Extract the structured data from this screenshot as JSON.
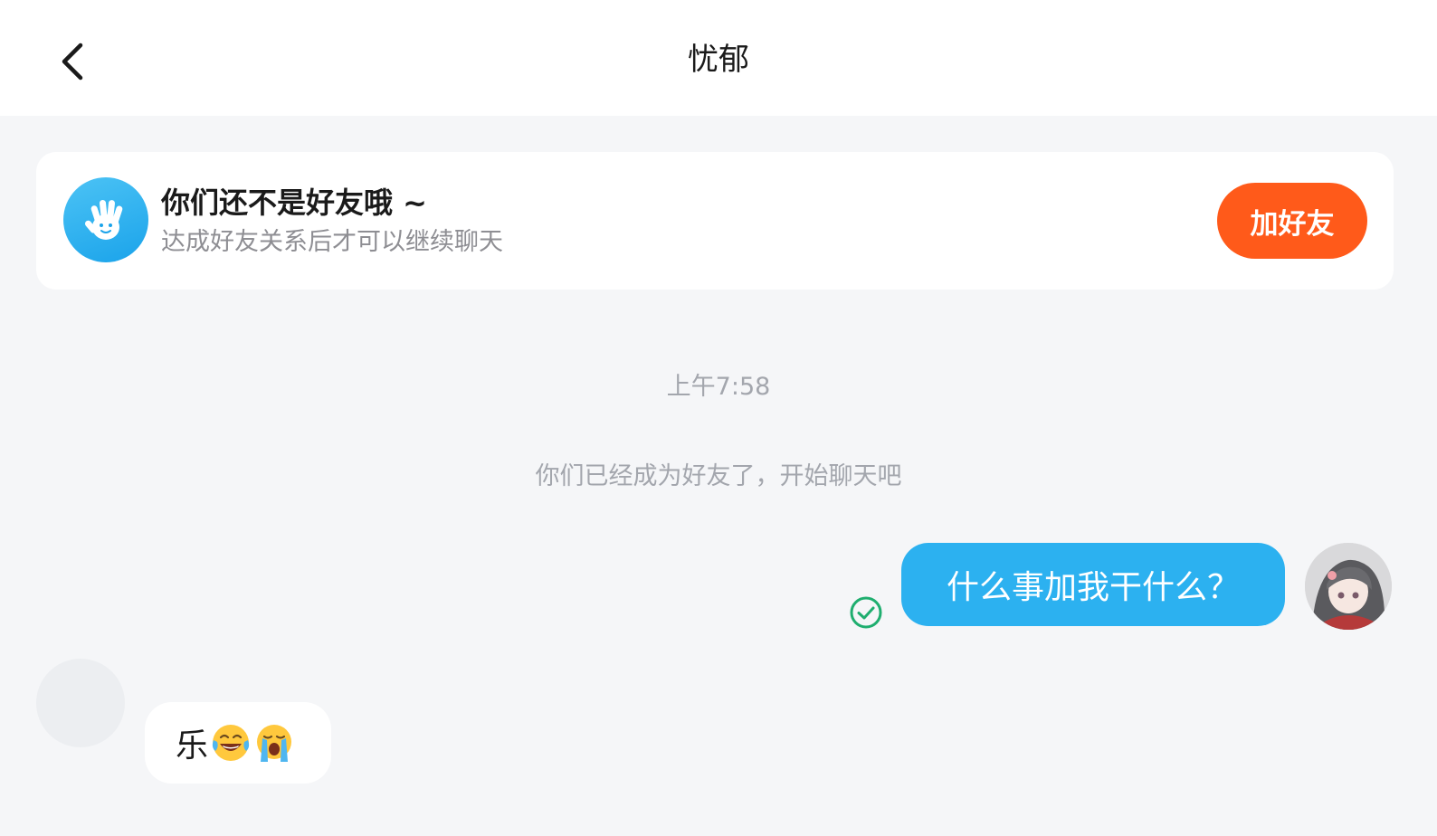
{
  "header": {
    "title": "忧郁",
    "back_icon": "chevron-left-icon"
  },
  "notice": {
    "icon": "waving-hand-icon",
    "title": "你们还不是好友哦 ~",
    "subtitle": "达成好友关系后才可以继续聊天",
    "add_button_label": "加好友"
  },
  "chat": {
    "timestamp": "上午7:58",
    "system_message": "你们已经成为好友了，开始聊天吧",
    "messages": [
      {
        "direction": "outgoing",
        "text": "什么事加我干什么？",
        "status_icon": "sent-check-icon"
      },
      {
        "direction": "incoming",
        "text": "乐",
        "emojis": [
          "tears-of-joy-emoji",
          "loudly-crying-emoji"
        ]
      }
    ]
  },
  "colors": {
    "accent_orange": "#ff5a1a",
    "bubble_blue": "#2cb1f0",
    "check_green": "#1fae6f",
    "background": "#f5f6f8"
  }
}
